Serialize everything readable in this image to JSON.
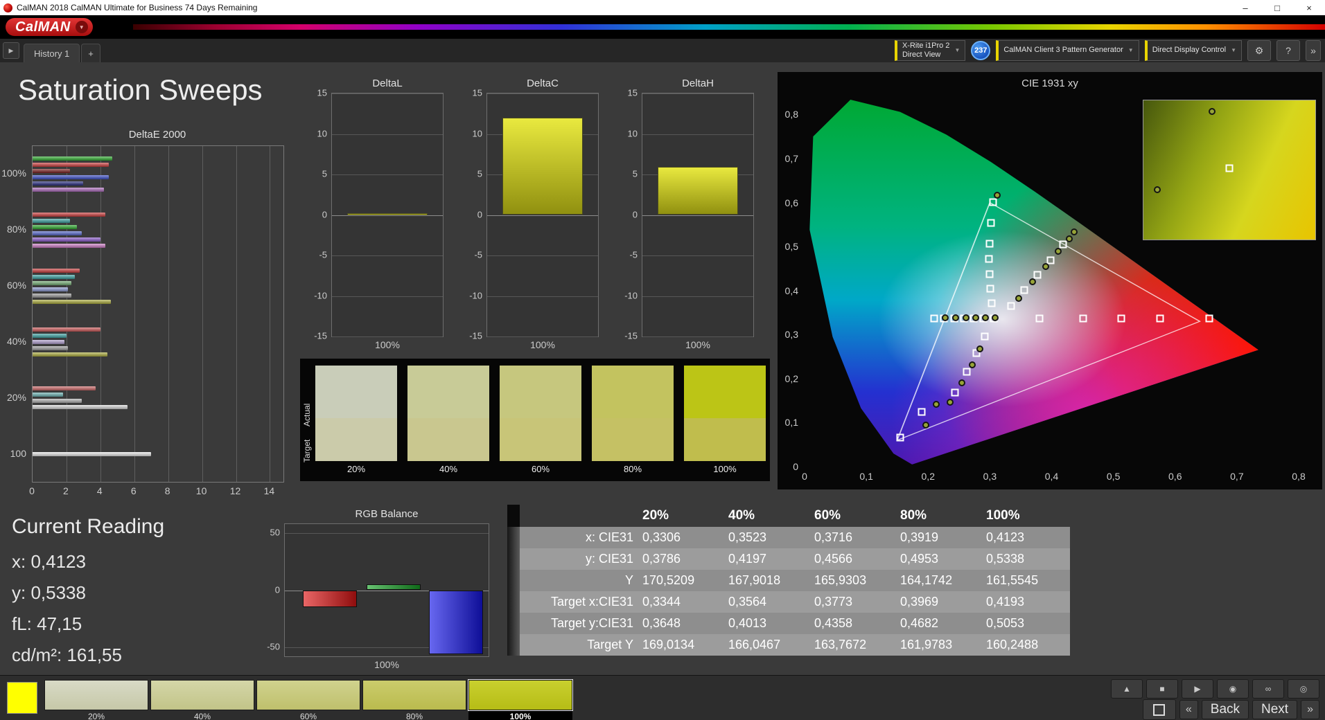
{
  "window": {
    "title": "CalMAN 2018 CalMAN Ultimate for Business 74 Days Remaining",
    "minimize": "–",
    "maximize": "□",
    "close": "×"
  },
  "logo": {
    "brand": "CalMAN",
    "caret": "▼"
  },
  "tabbar": {
    "collapse": "▶",
    "history_tab": "History 1",
    "add_tab": "+"
  },
  "devices": {
    "meter_line1": "X-Rite i1Pro 2",
    "meter_line2": "Direct View",
    "badge": "237",
    "pattern_generator": "CalMAN Client 3 Pattern Generator",
    "display_control": "Direct Display Control",
    "caret": "▼",
    "gear": "⚙",
    "help": "?",
    "expand": "»"
  },
  "page": {
    "title": "Saturation Sweeps"
  },
  "current_reading": {
    "title": "Current Reading",
    "lines": [
      "x: 0,4123",
      "y: 0,5338",
      "fL: 47,15",
      "cd/m²: 161,55"
    ]
  },
  "bottom": {
    "active_color": "#ffff00",
    "patches": [
      {
        "label": "20%",
        "top": "#d8dac6",
        "bottom": "#c6c8a8",
        "selected": false
      },
      {
        "label": "40%",
        "top": "#d4d6a8",
        "bottom": "#c2c488",
        "selected": false
      },
      {
        "label": "60%",
        "top": "#d0d28e",
        "bottom": "#bfc06c",
        "selected": false
      },
      {
        "label": "80%",
        "top": "#cbcc6c",
        "bottom": "#babb4e",
        "selected": false
      },
      {
        "label": "100%",
        "top": "#c9d02e",
        "bottom": "#b6bc16",
        "selected": true
      }
    ],
    "transport": [
      {
        "name": "eject",
        "glyph": "▲"
      },
      {
        "name": "stop",
        "glyph": "■"
      },
      {
        "name": "play",
        "glyph": "▶"
      },
      {
        "name": "capture",
        "glyph": "◉"
      },
      {
        "name": "loop",
        "glyph": "∞"
      },
      {
        "name": "power",
        "glyph": "◎"
      }
    ],
    "prev_chevron": "«",
    "back_label": "Back",
    "next_label": "Next",
    "next_chevron": "»"
  },
  "chart_data": [
    {
      "id": "deltae2000",
      "type": "bar",
      "orientation": "horizontal",
      "title": "DeltaE 2000",
      "xlim": [
        0,
        14.8
      ],
      "xticks": [
        0,
        2,
        4,
        6,
        8,
        10,
        12,
        14
      ],
      "grid": true,
      "groups": [
        {
          "label": "100%",
          "bars": [
            {
              "color": "#2fae2f",
              "value": 4.7
            },
            {
              "color": "#d03c3c",
              "value": 4.5
            },
            {
              "color": "#7c1e1e",
              "value": 2.2
            },
            {
              "color": "#3c50cc",
              "value": 4.5
            },
            {
              "color": "#262b80",
              "value": 3.0
            },
            {
              "color": "#b06cc0",
              "value": 4.2
            }
          ]
        },
        {
          "label": "80%",
          "bars": [
            {
              "color": "#d03c3c",
              "value": 4.3
            },
            {
              "color": "#3ca6a6",
              "value": 2.2
            },
            {
              "color": "#2fae2f",
              "value": 2.6
            },
            {
              "color": "#5668d0",
              "value": 2.9
            },
            {
              "color": "#8c5ad0",
              "value": 4.0
            },
            {
              "color": "#d07cc8",
              "value": 4.3
            }
          ]
        },
        {
          "label": "60%",
          "bars": [
            {
              "color": "#d03c3c",
              "value": 2.8
            },
            {
              "color": "#3ca6a6",
              "value": 2.5
            },
            {
              "color": "#74b074",
              "value": 2.3
            },
            {
              "color": "#8c9ad4",
              "value": 2.1
            },
            {
              "color": "#9c9c9c",
              "value": 2.3
            },
            {
              "color": "#b0b03c",
              "value": 4.6
            }
          ]
        },
        {
          "label": "40%",
          "bars": [
            {
              "color": "#d05858",
              "value": 4.0
            },
            {
              "color": "#3ca6a6",
              "value": 2.0
            },
            {
              "color": "#b4a2d4",
              "value": 1.9
            },
            {
              "color": "#a0a0a0",
              "value": 2.1
            },
            {
              "color": "#b0b03c",
              "value": 4.4
            }
          ]
        },
        {
          "label": "20%",
          "bars": [
            {
              "color": "#d06868",
              "value": 3.7
            },
            {
              "color": "#6cb6b6",
              "value": 1.8
            },
            {
              "color": "#b4b4b4",
              "value": 2.9
            },
            {
              "color": "#dcdcdc",
              "value": 5.6
            }
          ]
        },
        {
          "label": "100",
          "bars": [
            {
              "color": "#ececec",
              "value": 7.0
            }
          ]
        }
      ]
    },
    {
      "id": "deltaL",
      "type": "bar",
      "title": "DeltaL",
      "categories": [
        "100%"
      ],
      "values": [
        0.2
      ],
      "ylim": [
        -15,
        15
      ],
      "yticks": [
        15,
        10,
        5,
        0,
        -5,
        -10,
        -15
      ],
      "grid": true
    },
    {
      "id": "deltaC",
      "type": "bar",
      "title": "DeltaC",
      "categories": [
        "100%"
      ],
      "values": [
        12.0
      ],
      "ylim": [
        -15,
        15
      ],
      "yticks": [
        15,
        10,
        5,
        0,
        -5,
        -10,
        -15
      ],
      "grid": true
    },
    {
      "id": "deltaH",
      "type": "bar",
      "title": "DeltaH",
      "categories": [
        "100%"
      ],
      "values": [
        5.9
      ],
      "ylim": [
        -15,
        15
      ],
      "yticks": [
        15,
        10,
        5,
        0,
        -5,
        -10,
        -15
      ],
      "grid": true
    },
    {
      "id": "rgb_balance",
      "type": "bar",
      "title": "RGB Balance",
      "categories": [
        "100%"
      ],
      "ylim": [
        -58,
        58
      ],
      "yticks": [
        50,
        0,
        -50
      ],
      "grid": true,
      "series": [
        {
          "name": "Red",
          "color": "#dd1414",
          "values": [
            -15
          ]
        },
        {
          "name": "Green",
          "color": "#17a226",
          "values": [
            5
          ]
        },
        {
          "name": "Blue",
          "color": "#1616e8",
          "values": [
            -56
          ]
        }
      ]
    },
    {
      "id": "saturation_swatches",
      "type": "table",
      "row_labels": [
        "Actual",
        "Target"
      ],
      "columns": [
        "20%",
        "40%",
        "60%",
        "80%",
        "100%"
      ],
      "actual_colors": [
        "#c9cdb9",
        "#c8cb97",
        "#c6c77e",
        "#c3c35f",
        "#bcc516"
      ],
      "target_colors": [
        "#cbcbaa",
        "#c9c78f",
        "#c8c578",
        "#c5c164",
        "#c0bd4d"
      ]
    },
    {
      "id": "cie",
      "type": "scatter",
      "title": "CIE 1931 xy",
      "xlim": [
        0,
        0.8
      ],
      "ylim": [
        0,
        0.8
      ],
      "xticks": [
        "0",
        "0,1",
        "0,2",
        "0,3",
        "0,4",
        "0,5",
        "0,6",
        "0,7",
        "0,8"
      ],
      "yticks": [
        "0,8",
        "0,7",
        "0,6",
        "0,5",
        "0,4",
        "0,3",
        "0,2",
        "0,1",
        "0"
      ],
      "gamut_triangle": [
        [
          0.3,
          0.6
        ],
        [
          0.64,
          0.33
        ],
        [
          0.15,
          0.06
        ]
      ],
      "targets": [
        [
          0.21,
          0.337
        ],
        [
          0.226,
          0.337
        ],
        [
          0.242,
          0.337
        ],
        [
          0.258,
          0.337
        ],
        [
          0.274,
          0.337
        ],
        [
          0.29,
          0.337
        ],
        [
          0.306,
          0.337
        ],
        [
          0.38,
          0.337
        ],
        [
          0.451,
          0.337
        ],
        [
          0.513,
          0.337
        ],
        [
          0.576,
          0.337
        ],
        [
          0.655,
          0.337
        ],
        [
          0.303,
          0.372
        ],
        [
          0.301,
          0.405
        ],
        [
          0.3,
          0.438
        ],
        [
          0.299,
          0.472
        ],
        [
          0.3,
          0.506
        ],
        [
          0.302,
          0.553
        ],
        [
          0.305,
          0.601
        ],
        [
          0.334,
          0.365
        ],
        [
          0.356,
          0.401
        ],
        [
          0.377,
          0.436
        ],
        [
          0.398,
          0.469
        ],
        [
          0.419,
          0.505
        ],
        [
          0.292,
          0.295
        ],
        [
          0.278,
          0.258
        ],
        [
          0.262,
          0.215
        ],
        [
          0.243,
          0.168
        ],
        [
          0.19,
          0.125
        ],
        [
          0.155,
          0.066
        ]
      ],
      "measured": [
        [
          0.228,
          0.338
        ],
        [
          0.245,
          0.338
        ],
        [
          0.261,
          0.338
        ],
        [
          0.277,
          0.338
        ],
        [
          0.293,
          0.338
        ],
        [
          0.309,
          0.338
        ],
        [
          0.312,
          0.617
        ],
        [
          0.347,
          0.383
        ],
        [
          0.369,
          0.42
        ],
        [
          0.39,
          0.454
        ],
        [
          0.411,
          0.489
        ],
        [
          0.429,
          0.517
        ],
        [
          0.437,
          0.533
        ],
        [
          0.284,
          0.268
        ],
        [
          0.272,
          0.232
        ],
        [
          0.255,
          0.19
        ],
        [
          0.236,
          0.147
        ],
        [
          0.213,
          0.142
        ],
        [
          0.196,
          0.095
        ]
      ],
      "inset_points": [
        {
          "type": "circle",
          "x": 0.4,
          "y": 0.08
        },
        {
          "type": "square",
          "x": 0.5,
          "y": 0.49
        },
        {
          "type": "circle",
          "x": 0.08,
          "y": 0.64
        }
      ]
    },
    {
      "id": "measurements",
      "type": "table",
      "columns": [
        "20%",
        "40%",
        "60%",
        "80%",
        "100%"
      ],
      "rows": [
        {
          "label": "x: CIE31",
          "values": [
            "0,3306",
            "0,3523",
            "0,3716",
            "0,3919",
            "0,4123"
          ]
        },
        {
          "label": "y: CIE31",
          "values": [
            "0,3786",
            "0,4197",
            "0,4566",
            "0,4953",
            "0,5338"
          ]
        },
        {
          "label": "Y",
          "values": [
            "170,5209",
            "167,9018",
            "165,9303",
            "164,1742",
            "161,5545"
          ]
        },
        {
          "label": "Target x:CIE31",
          "values": [
            "0,3344",
            "0,3564",
            "0,3773",
            "0,3969",
            "0,4193"
          ]
        },
        {
          "label": "Target y:CIE31",
          "values": [
            "0,3648",
            "0,4013",
            "0,4358",
            "0,4682",
            "0,5053"
          ]
        },
        {
          "label": "Target Y",
          "values": [
            "169,0134",
            "166,0467",
            "163,7672",
            "161,9783",
            "160,2488"
          ]
        }
      ]
    }
  ]
}
